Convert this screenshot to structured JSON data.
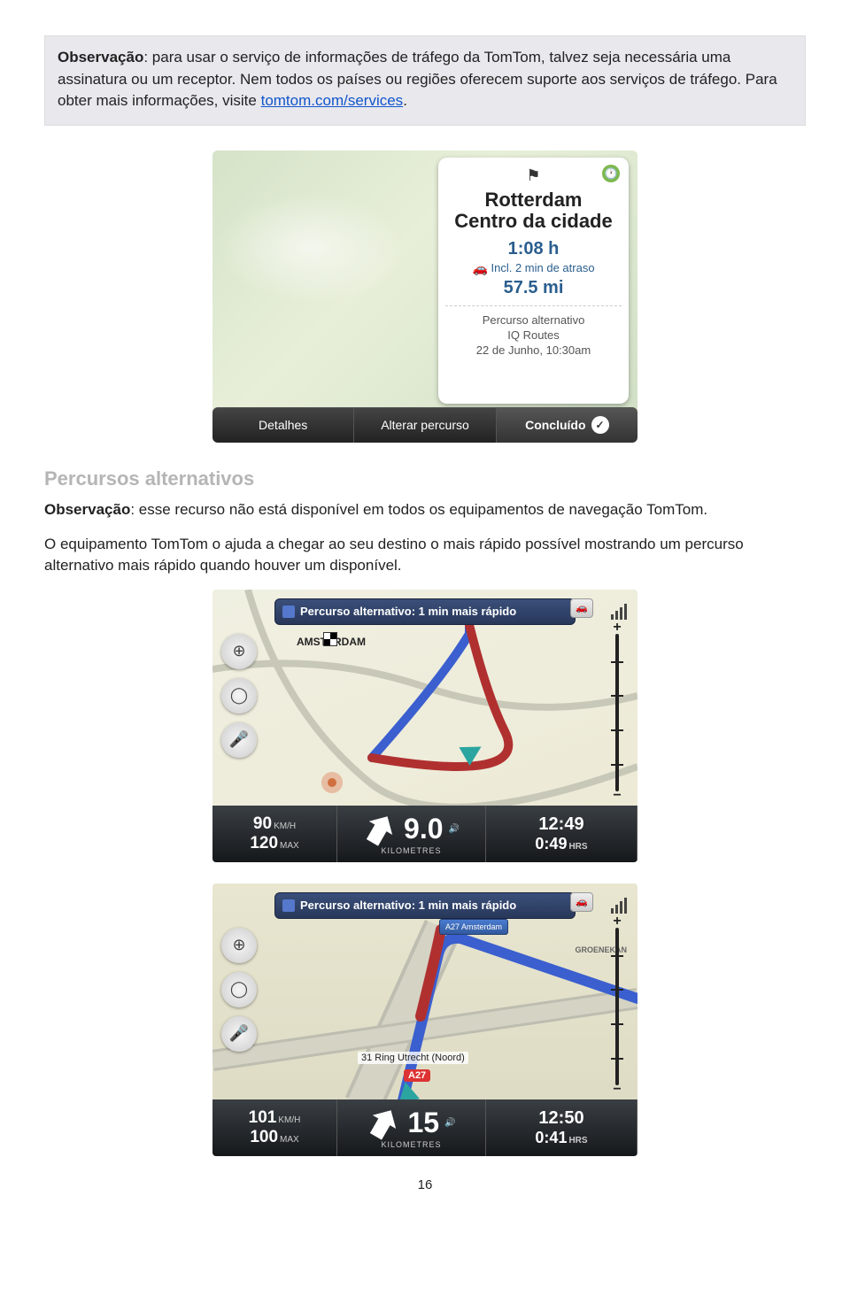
{
  "noteBox": {
    "label": "Observação",
    "text1": ": para usar o serviço de informações de tráfego da TomTom, talvez seja necessária uma assinatura ou um receptor. Nem todos os países ou regiões oferecem suporte aos serviços de tráfego. Para obter mais informações, visite ",
    "link": "tomtom.com/services",
    "text2": "."
  },
  "fig1": {
    "destTitle1": "Rotterdam",
    "destTitle2": "Centro da cidade",
    "time": "1:08 h",
    "delay": "Incl. 2 min de atraso",
    "distance": "57.5 mi",
    "altLine1": "Percurso alternativo",
    "altLine2": "IQ Routes",
    "altLine3": "22 de Junho, 10:30am",
    "btnDetalhes": "Detalhes",
    "btnAlterar": "Alterar percurso",
    "btnConcluido": "Concluído"
  },
  "section": {
    "heading": "Percursos alternativos",
    "noteLabel": "Observação",
    "noteText": ": esse recurso não está disponível em todos os equipamentos de navegação TomTom.",
    "para": "O equipamento TomTom o ajuda a chegar ao seu destino o mais rápido possível mostrando um percurso alternativo mais rápido quando houver um disponível."
  },
  "fig2": {
    "banner": "Percurso alternativo: 1 min mais rápido",
    "city": "AMSTERDAM",
    "speed": "90",
    "speedUnit": "KM/H",
    "max": "120",
    "maxLabel": "MAX",
    "distance": "9.0",
    "distLabel": "KILOMETRES",
    "clock": "12:49",
    "remain": "0:49",
    "hrs": "HRS"
  },
  "fig3": {
    "banner": "Percurso alternativo: 1 min mais rápido",
    "exitSign": "A27 Amsterdam",
    "roadLabel": "31 Ring Utrecht (Noord)",
    "shield": "A27",
    "groen": "GROENEKAN",
    "speed": "101",
    "speedUnit": "KM/H",
    "max": "100",
    "maxLabel": "MAX",
    "distance": "15",
    "distLabel": "KILOMETRES",
    "clock": "12:50",
    "remain": "0:41",
    "hrs": "HRS"
  },
  "pageNumber": "16"
}
